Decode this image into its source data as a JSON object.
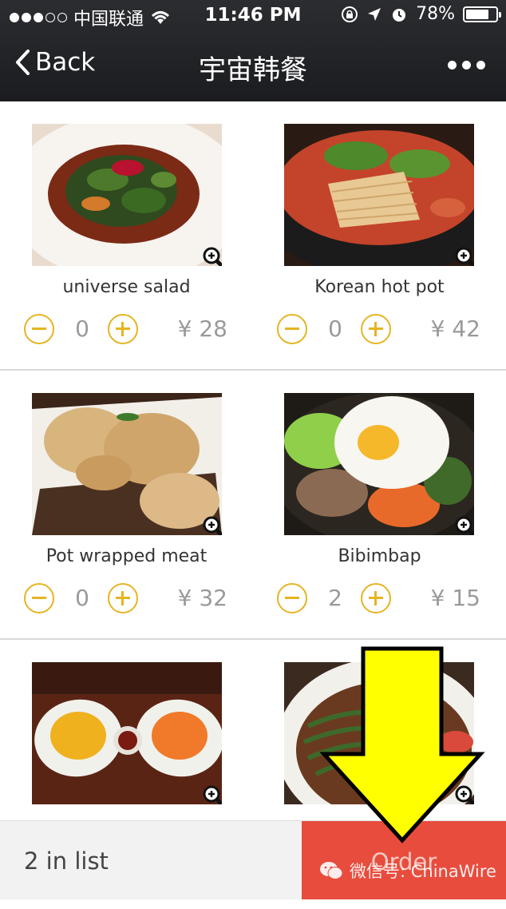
{
  "status": {
    "carrier": "中国联通",
    "time": "11:46 PM",
    "battery": "78%",
    "battery_level": 0.78
  },
  "nav": {
    "back_label": "Back",
    "title": "宇宙韩餐"
  },
  "menu": [
    {
      "name": "universe salad",
      "qty": "0",
      "price": "¥ 28"
    },
    {
      "name": "Korean hot pot",
      "qty": "0",
      "price": "¥ 42"
    },
    {
      "name": "Pot wrapped meat",
      "qty": "0",
      "price": "¥ 32"
    },
    {
      "name": "Bibimbap",
      "qty": "2",
      "price": "¥ 15"
    },
    {
      "name": "",
      "qty": "",
      "price": ""
    },
    {
      "name": "",
      "qty": "",
      "price": ""
    }
  ],
  "bottom": {
    "count_label": "2 in list",
    "order_label": "Order"
  },
  "watermark": "微信号: ChinaWire",
  "colors": {
    "accent": "#e6b422",
    "order": "#e84c3d",
    "arrow": "#ffff00"
  }
}
